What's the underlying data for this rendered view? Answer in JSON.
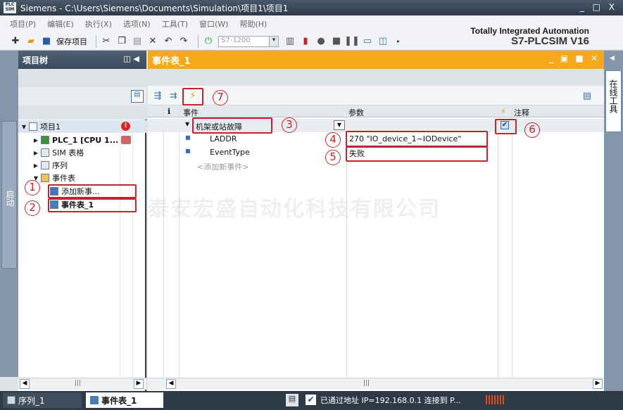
{
  "window": {
    "app_label": "PLC SIM",
    "title": "Siemens   -   C:\\Users\\Siemens\\Documents\\Simulation\\项目1\\项目1",
    "controls": "_ □ X"
  },
  "menu": [
    "项目(P)",
    "编辑(E)",
    "执行(X)",
    "选项(N)",
    "工具(T)",
    "窗口(W)",
    "帮助(H)"
  ],
  "toolbar": {
    "save_project_label": "保存项目",
    "cpu_combo_placeholder": "S7-1200"
  },
  "brand": {
    "line1": "Totally Integrated Automation",
    "line2": "S7-PLCSIM V16"
  },
  "left_strip": {
    "label": "启动"
  },
  "project_tree": {
    "title": "项目树",
    "items": [
      {
        "label": "项目1",
        "level": 0
      },
      {
        "label": "PLC_1 [CPU 1...",
        "level": 1
      },
      {
        "label": "SIM 表格",
        "level": 1
      },
      {
        "label": "序列",
        "level": 1
      },
      {
        "label": "事件表",
        "level": 1
      },
      {
        "label": "添加新事...",
        "level": 2
      },
      {
        "label": "事件表_1",
        "level": 2
      }
    ]
  },
  "editor": {
    "title": "事件表_1",
    "columns": {
      "info": "i",
      "event": "事件",
      "params": "参数",
      "comment": "注释"
    },
    "rows": [
      {
        "event": "机架或站故障",
        "param": "",
        "enabled": true
      },
      {
        "event": "LADDR",
        "param": "270 \"IO_device_1~IODevice\""
      },
      {
        "event": "EventType",
        "param": "失败"
      },
      {
        "event": "<添加新事件>",
        "param": ""
      }
    ]
  },
  "right_strip": {
    "label": "在线工具"
  },
  "status": {
    "tabs": [
      "序列_1",
      "事件表_1"
    ],
    "connection_text": "已通过地址 IP=192.168.0.1 连接到 P..."
  },
  "annotations": [
    "1",
    "2",
    "3",
    "4",
    "5",
    "6",
    "7"
  ],
  "watermark": "泰安宏盛自动化科技有限公司",
  "colors": {
    "editor_header": "#f6a81d",
    "annotation": "#c0242d",
    "dark_bar": "#2f3a47"
  }
}
